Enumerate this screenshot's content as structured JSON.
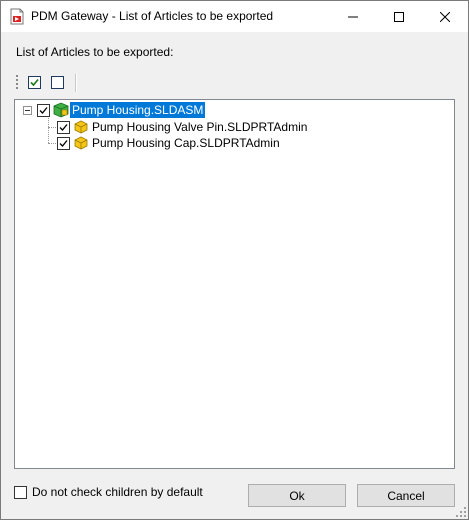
{
  "window": {
    "title": "PDM Gateway - List of Articles to be exported",
    "controls": [
      "minimize-icon",
      "maximize-icon",
      "close-icon"
    ]
  },
  "section_label": "List of Articles to be exported:",
  "toolbar": {
    "check_all_icon": "checked-checkbox-icon",
    "uncheck_all_icon": "unchecked-checkbox-icon"
  },
  "tree": {
    "root": {
      "label": "Pump Housing.SLDASM",
      "checked": true,
      "expanded": true,
      "selected": true,
      "icon": "assembly-icon"
    },
    "children": [
      {
        "label": "Pump Housing Valve Pin.SLDPRTAdmin",
        "checked": true,
        "icon": "part-icon"
      },
      {
        "label": "Pump Housing Cap.SLDPRTAdmin",
        "checked": true,
        "icon": "part-icon"
      }
    ]
  },
  "options": {
    "no_check_children_label": "Do not check children by default",
    "no_check_children_checked": false
  },
  "buttons": {
    "ok_label": "Ok",
    "cancel_label": "Cancel"
  },
  "colors": {
    "selection": "#0078d7",
    "part_icon": "#f5c518",
    "assembly_icon": "#3cb043"
  }
}
